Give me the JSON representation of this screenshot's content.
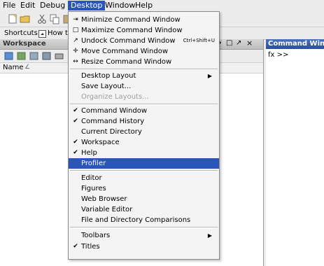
{
  "menubar": [
    "File",
    "Edit",
    "Debug",
    "Desktop",
    "Window",
    "Help"
  ],
  "toolbar2": {
    "shortcuts_label": "Shortcuts",
    "howto_label": "How to"
  },
  "workspace": {
    "title": "Workspace",
    "column_name": "Name",
    "sort_indicator": "∠"
  },
  "command_window": {
    "title": "Command Window",
    "prompt": "fx >>"
  },
  "desktop_menu": {
    "items": [
      {
        "icon": "⇥",
        "label": "Minimize Command Window"
      },
      {
        "icon": "□",
        "label": "Maximize Command Window"
      },
      {
        "icon": "↗",
        "label": "Undock Command Window",
        "accel": "Ctrl+Shift+U"
      },
      {
        "icon": "✛",
        "label": "Move Command Window"
      },
      {
        "icon": "↔",
        "label": "Resize Command Window"
      },
      {
        "label": "Desktop Layout",
        "submenu": true
      },
      {
        "label": "Save Layout..."
      },
      {
        "label": "Organize Layouts...",
        "disabled": true
      },
      {
        "check": true,
        "label": "Command Window"
      },
      {
        "check": true,
        "label": "Command History"
      },
      {
        "label": "Current Directory"
      },
      {
        "check": true,
        "label": "Workspace"
      },
      {
        "check": true,
        "label": "Help"
      },
      {
        "label": "Profiler",
        "selected": true
      },
      {
        "label": "Editor"
      },
      {
        "label": "Figures"
      },
      {
        "label": "Web Browser"
      },
      {
        "label": "Variable Editor"
      },
      {
        "label": "File and Directory Comparisons"
      },
      {
        "label": "Toolbars",
        "submenu": true
      },
      {
        "check": true,
        "label": "Titles"
      }
    ]
  }
}
